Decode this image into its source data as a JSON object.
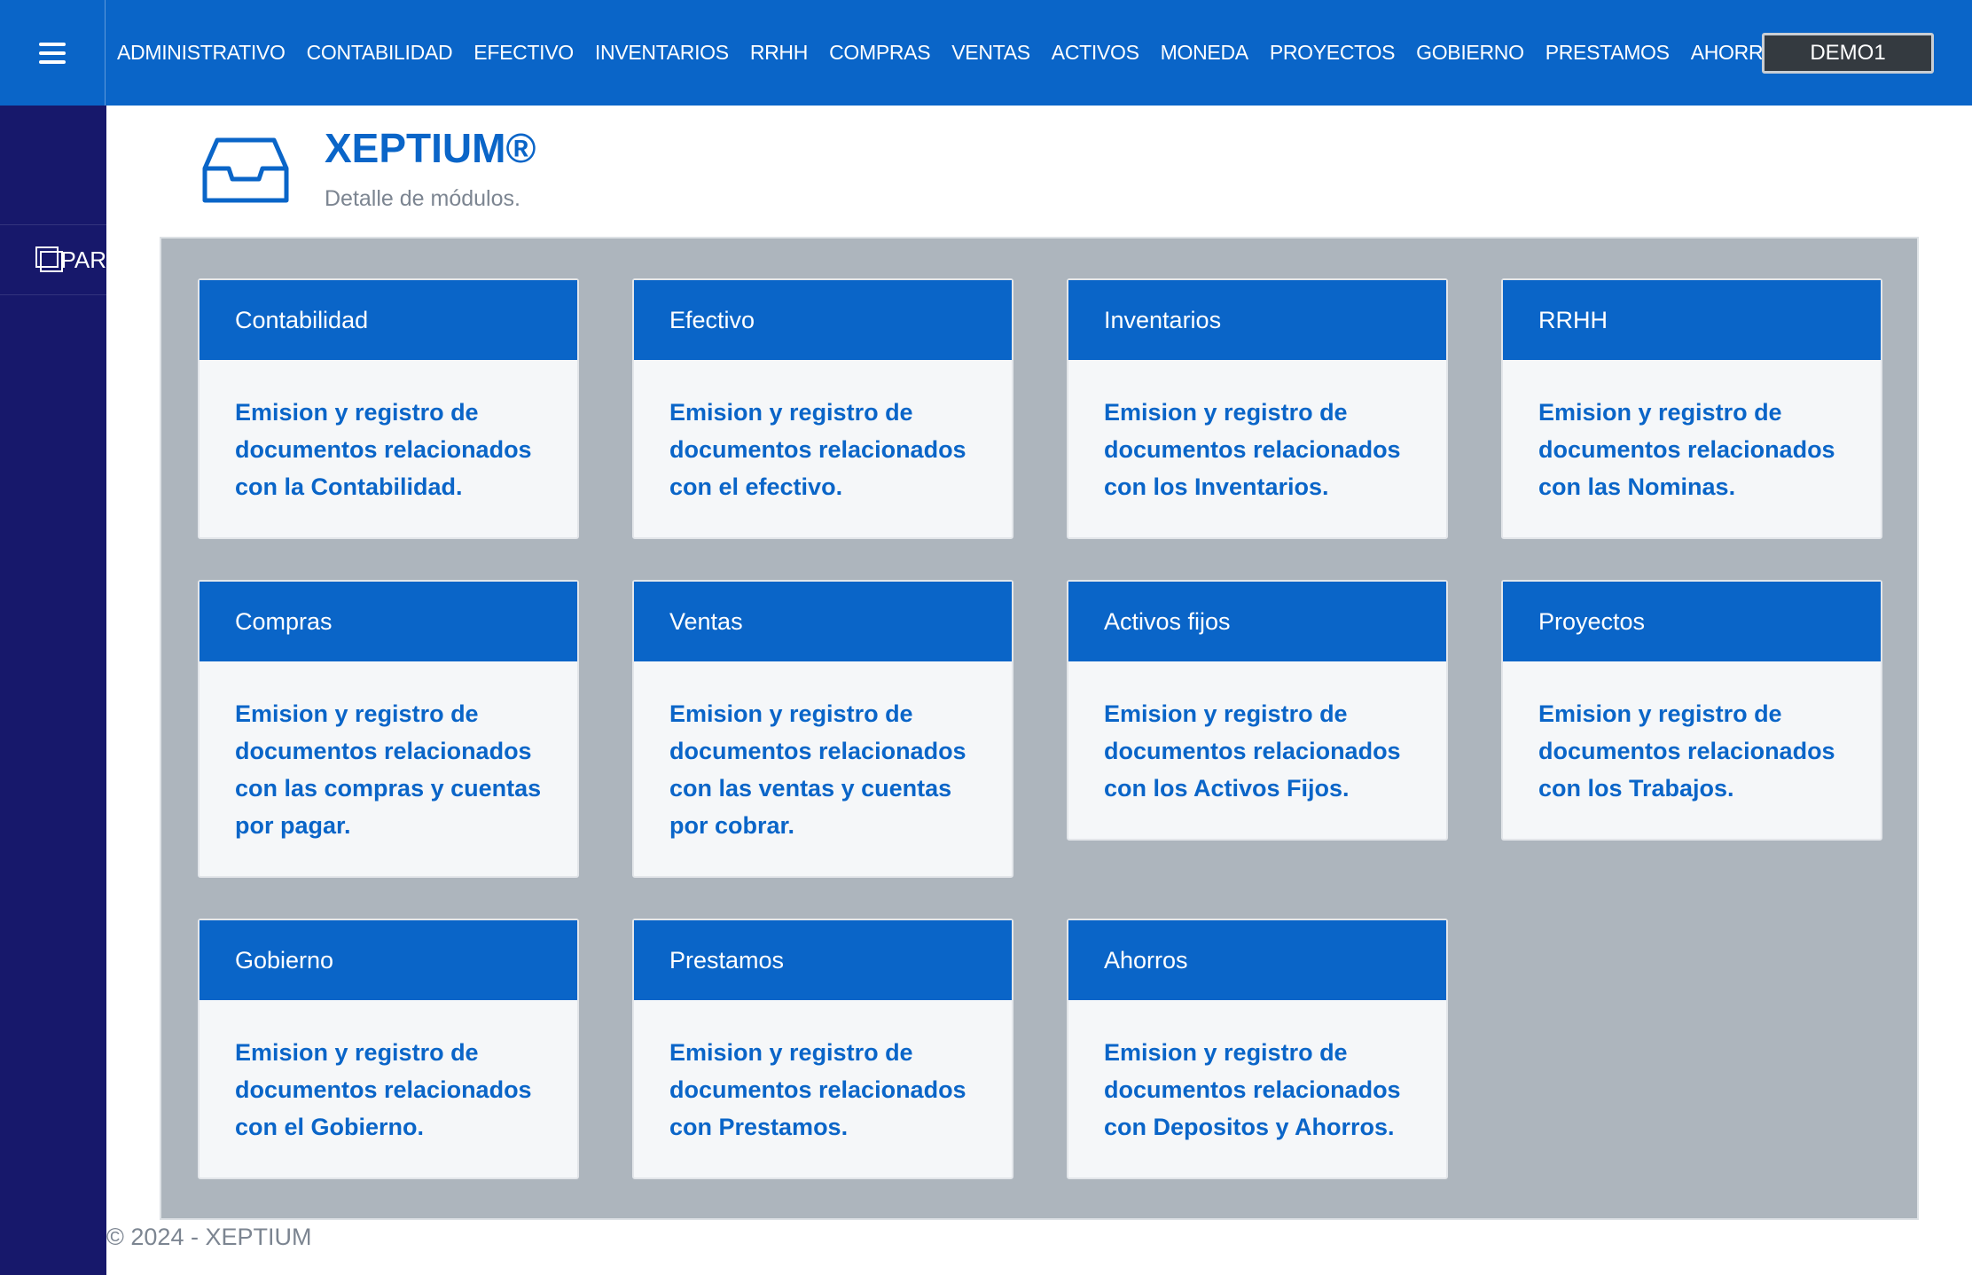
{
  "topbar": {
    "menu_icon": "hamburger-icon",
    "nav": [
      "ADMINISTRATIVO",
      "CONTABILIDAD",
      "EFECTIVO",
      "INVENTARIOS",
      "RRHH",
      "COMPRAS",
      "VENTAS",
      "ACTIVOS",
      "MONEDA",
      "PROYECTOS",
      "GOBIERNO",
      "PRESTAMOS",
      "AHORROS"
    ],
    "user": "DEMO1"
  },
  "sidebar": {
    "items": [
      {
        "label": "PAR",
        "icon": "copy-icon"
      }
    ]
  },
  "header": {
    "icon": "inbox-icon",
    "title": "XEPTIUM®",
    "subtitle": "Detalle de módulos."
  },
  "modules": [
    {
      "title": "Contabilidad",
      "description": "Emision y registro de documentos relacionados con la Contabilidad."
    },
    {
      "title": "Efectivo",
      "description": "Emision y registro de documentos relacionados con el efectivo."
    },
    {
      "title": "Inventarios",
      "description": "Emision y registro de documentos relacionados con los Inventarios."
    },
    {
      "title": "RRHH",
      "description": "Emision y registro de documentos relacionados con las Nominas."
    },
    {
      "title": "Compras",
      "description": "Emision y registro de documentos relacionados con las compras y cuentas por pagar."
    },
    {
      "title": "Ventas",
      "description": "Emision y registro de documentos relacionados con las ventas y cuentas por cobrar."
    },
    {
      "title": "Activos fijos",
      "description": "Emision y registro de documentos relacionados con los Activos Fijos."
    },
    {
      "title": "Proyectos",
      "description": "Emision y registro de documentos relacionados con los Trabajos."
    },
    {
      "title": "Gobierno",
      "description": "Emision y registro de documentos relacionados con el Gobierno."
    },
    {
      "title": "Prestamos",
      "description": "Emision y registro de documentos relacionados con Prestamos."
    },
    {
      "title": "Ahorros",
      "description": "Emision y registro de documentos relacionados con Depositos y Ahorros."
    }
  ],
  "footer": {
    "text": "© 2024 - XEPTIUM"
  },
  "colors": {
    "primary": "#0a65c8",
    "sidebar": "#17186b",
    "panel": "#adb5bd",
    "card_body": "#f5f7f9",
    "user_button": "#343a40"
  }
}
